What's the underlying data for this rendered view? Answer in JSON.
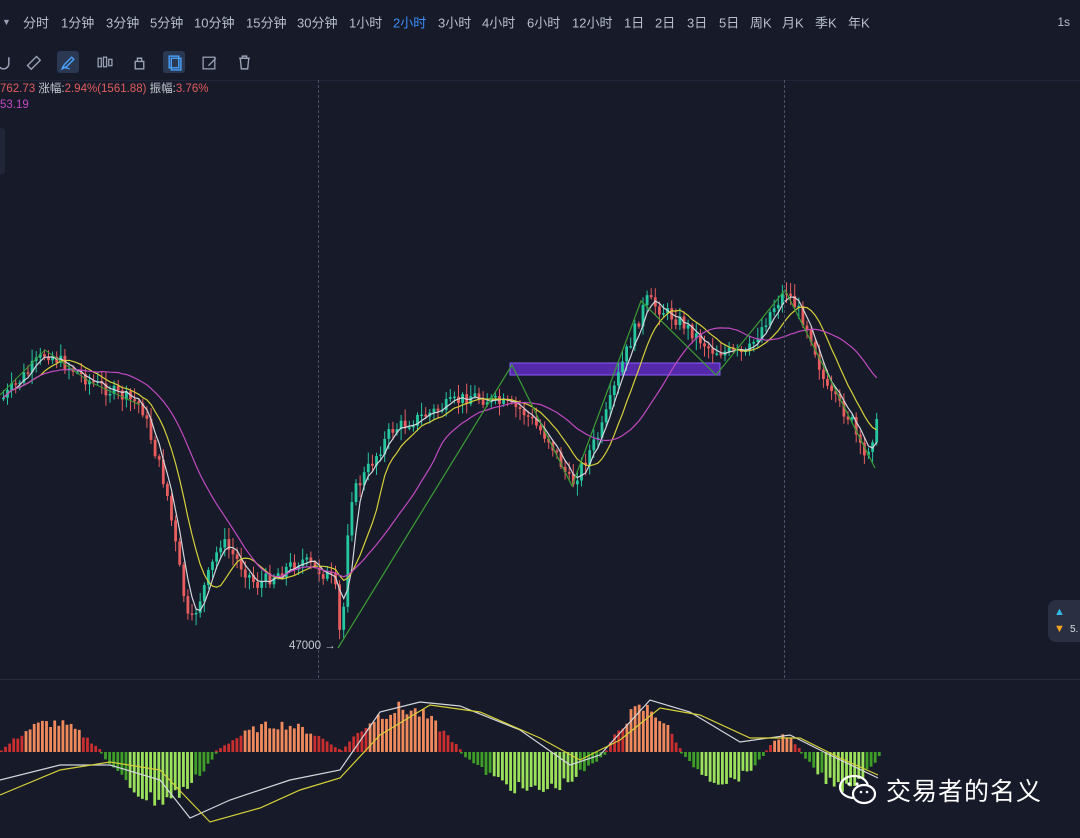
{
  "toolbar": {
    "intervals": [
      "分时",
      "1分钟",
      "3分钟",
      "5分钟",
      "10分钟",
      "15分钟",
      "30分钟",
      "1小时",
      "2小时",
      "3小时",
      "4小时",
      "6小时",
      "12小时",
      "1日",
      "2日",
      "3日",
      "5日",
      "周K",
      "月K",
      "季K",
      "年K"
    ],
    "active_interval": "2小时",
    "speed": "1s"
  },
  "drawing_tools": [
    "magnet-icon",
    "ruler-icon",
    "pencil-icon",
    "candles-icon",
    "lock-icon",
    "layers-icon",
    "edit-icon",
    "trash-icon"
  ],
  "info": {
    "value_prefix": "762.73",
    "change_label": "涨幅:",
    "change_value": "2.94%(1561.88)",
    "amplitude_label": "振幅:",
    "amplitude_value": "3.76%",
    "ma_value": "53.19"
  },
  "chart": {
    "low_label": "47000",
    "side_value": "5."
  },
  "watermark": {
    "text": "交易者的名义"
  },
  "colors": {
    "background": "#161a29",
    "up": "#25c6a0",
    "down": "#e85d5d",
    "ma_white": "#d4d6dc",
    "ma_yellow": "#d6cf3a",
    "ma_pink": "#c04ac0",
    "active_interval": "#3d8ef7",
    "zone": "#6a2fd6"
  }
}
